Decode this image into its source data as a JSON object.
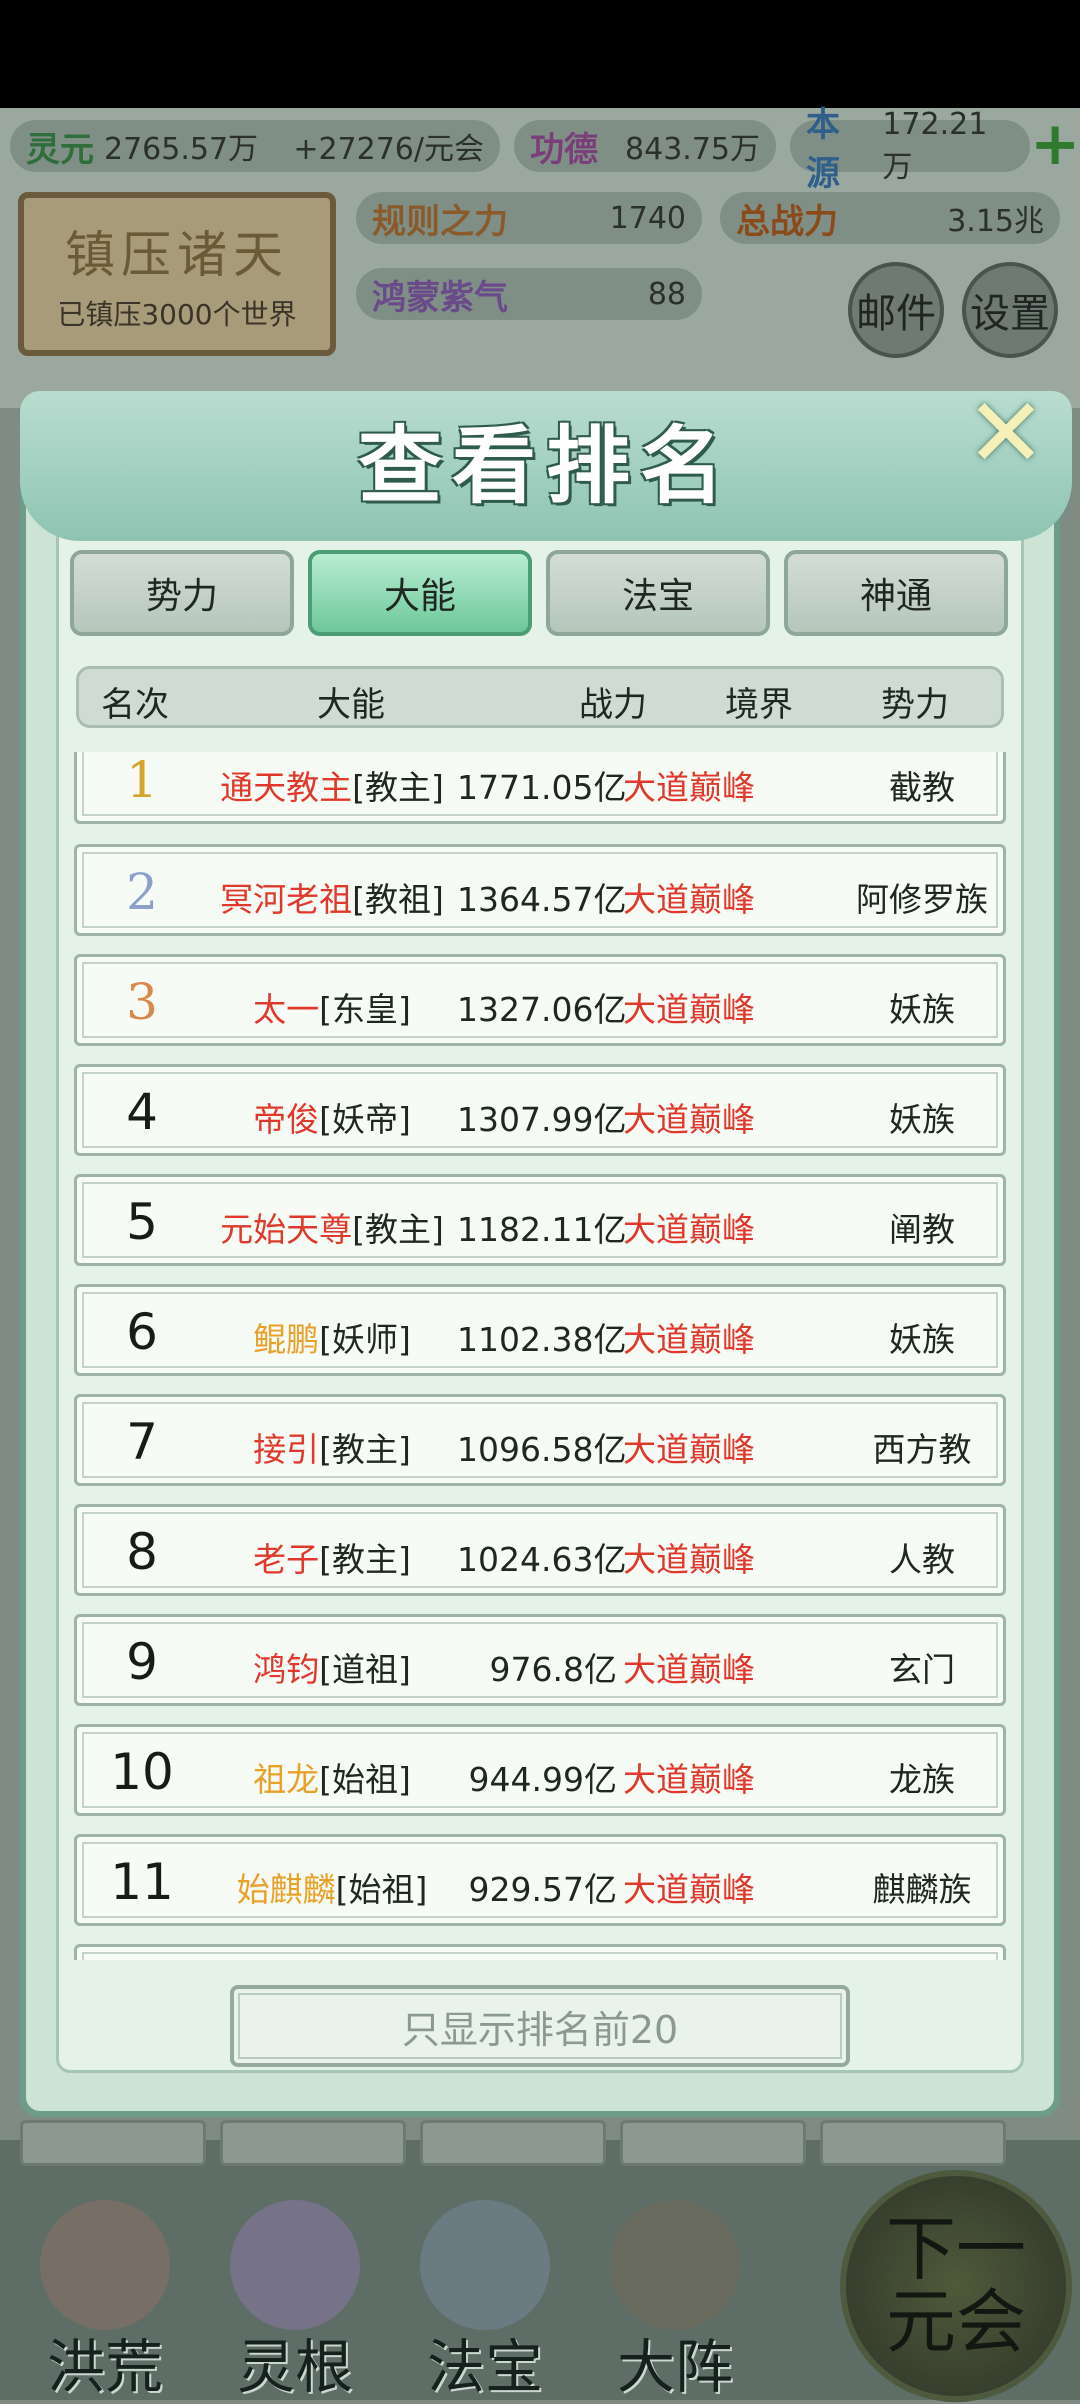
{
  "hud": {
    "lingyuan": {
      "label": "灵元",
      "value": "2765.57万",
      "rate": "+27276/元会"
    },
    "gongde": {
      "label": "功德",
      "value": "843.75万"
    },
    "benyuan": {
      "label": "本源",
      "value": "172.21万"
    },
    "guize": {
      "label": "规则之力",
      "value": "1740"
    },
    "zongzhanli": {
      "label": "总战力",
      "value": "3.15兆"
    },
    "hongmeng": {
      "label": "鸿蒙紫气",
      "value": "88"
    },
    "seal_title": "镇压诸天",
    "seal_sub": "已镇压3000个世界",
    "mail_label": "邮件",
    "settings_label": "设置"
  },
  "modal": {
    "title": "查看排名",
    "tabs": [
      "势力",
      "大能",
      "法宝",
      "神通"
    ],
    "active_tab": "大能",
    "columns": [
      "名次",
      "大能",
      "战力",
      "境界",
      "势力"
    ],
    "rows": [
      {
        "rank": "1",
        "name": "通天教主",
        "title": "[教主]",
        "power": "1771.05亿",
        "realm": "大道巅峰",
        "faction": "截教"
      },
      {
        "rank": "2",
        "name": "冥河老祖",
        "title": "[教祖]",
        "power": "1364.57亿",
        "realm": "大道巅峰",
        "faction": "阿修罗族"
      },
      {
        "rank": "3",
        "name": "太一",
        "title": "[东皇]",
        "power": "1327.06亿",
        "realm": "大道巅峰",
        "faction": "妖族"
      },
      {
        "rank": "4",
        "name": "帝俊",
        "title": "[妖帝]",
        "power": "1307.99亿",
        "realm": "大道巅峰",
        "faction": "妖族"
      },
      {
        "rank": "5",
        "name": "元始天尊",
        "title": "[教主]",
        "power": "1182.11亿",
        "realm": "大道巅峰",
        "faction": "阐教"
      },
      {
        "rank": "6",
        "name": "鲲鹏",
        "title": "[妖师]",
        "power": "1102.38亿",
        "realm": "大道巅峰",
        "faction": "妖族"
      },
      {
        "rank": "7",
        "name": "接引",
        "title": "[教主]",
        "power": "1096.58亿",
        "realm": "大道巅峰",
        "faction": "西方教"
      },
      {
        "rank": "8",
        "name": "老子",
        "title": "[教主]",
        "power": "1024.63亿",
        "realm": "大道巅峰",
        "faction": "人教"
      },
      {
        "rank": "9",
        "name": "鸿钧",
        "title": "[道祖]",
        "power": "976.8亿",
        "realm": "大道巅峰",
        "faction": "玄门"
      },
      {
        "rank": "10",
        "name": "祖龙",
        "title": "[始祖]",
        "power": "944.99亿",
        "realm": "大道巅峰",
        "faction": "龙族"
      },
      {
        "rank": "11",
        "name": "始麒麟",
        "title": "[始祖]",
        "power": "929.57亿",
        "realm": "大道巅峰",
        "faction": "麒麟族"
      }
    ],
    "footer_button": "只显示排名前20"
  },
  "bottom_nav": {
    "items": [
      "洪荒",
      "灵根",
      "法宝",
      "大阵"
    ],
    "next_button": "下一元会"
  },
  "colors": {
    "name_red": "#e0392b",
    "name_orange": "#e9a12a",
    "active_tab": "#6dc89a"
  }
}
